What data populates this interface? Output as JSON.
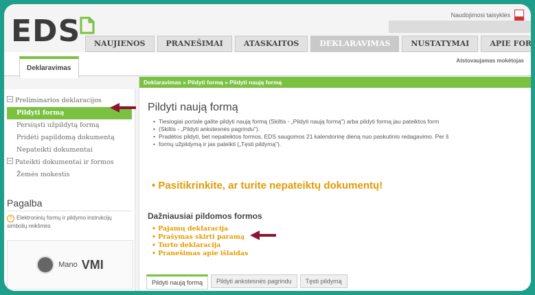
{
  "brand": {
    "logo": "EDS"
  },
  "header": {
    "top_link": "Naudojimosi taisyklės",
    "tabs": [
      {
        "label": "NAUJIENOS",
        "active": false
      },
      {
        "label": "PRANEŠIMAI",
        "active": false
      },
      {
        "label": "ATASKAITOS",
        "active": false
      },
      {
        "label": "DEKLARAVIMAS",
        "active": true
      },
      {
        "label": "NUSTATYMAI",
        "active": false
      },
      {
        "label": "APIE FORMŲ TEIKIMĄ",
        "active": false
      }
    ]
  },
  "subnav": {
    "tab": "Deklaravimas",
    "right_text": "Atstovaujamas mokėtojas"
  },
  "sidebar": {
    "items": [
      {
        "label": "Preliminarios deklaracijos",
        "group": true,
        "active": false
      },
      {
        "label": "Pildyti formą",
        "group": false,
        "active": true
      },
      {
        "label": "Persiųsti užpildytą formą",
        "group": false,
        "active": false
      },
      {
        "label": "Pridėti papildomą dokumentą",
        "group": false,
        "active": false
      },
      {
        "label": "Nepateikti dokumentai",
        "group": false,
        "active": false
      },
      {
        "label": "Pateikti dokumentai ir formos",
        "group": true,
        "active": false
      },
      {
        "label": "Žemės mokestis",
        "group": false,
        "active": false
      }
    ],
    "help_title": "Pagalba",
    "help_text": "Elektroninių formų ir pildymo instrukcijų simbolių reikšmės",
    "vmi_prefix": "Mano",
    "vmi_big": "VMI"
  },
  "main": {
    "breadcrumb": "Deklaravimas » Pildyti formą » Pildyti naują formą",
    "title": "Pildyti naują formą",
    "desc": [
      "Tiesiogiai portale galite pildyti naują formą (Skiltis - „Pildyti naują formą\") arba pildyti formą jau pateiktos form",
      "(Skiltis - „Pildyti ankstesnės pagrindu\").",
      "Pradėtos pildyti, bet nepateiktos formos, EDS saugomos 21 kalendorinę dieną nuo paskutinio redagavimo. Per š",
      "formų užpildymą ir jas pateikti („Tęsti pildymą\")."
    ],
    "check_text": "Pasitikrinkite, ar turite nepateiktų dokumentų!",
    "faq_title": "Dažniausiai pildomos formos",
    "forms": [
      "Pajamų deklaracija",
      "Prašymas skirti paramą",
      "Turto deklaracija",
      "Pranešimas apie išlaidas"
    ],
    "bottom_tabs": [
      {
        "label": "Pildyti naują formą",
        "active": true
      },
      {
        "label": "Pildyti ankstesnės pagrindu",
        "active": false
      },
      {
        "label": "Tęsti pildymą",
        "active": false
      }
    ]
  },
  "colors": {
    "frame": "#1f9e8c",
    "accent": "#7ac142",
    "orange": "#e39a00",
    "arrow": "#8b1530"
  },
  "icons": [
    "pdf-icon",
    "logo-document-icon",
    "collapse-box-icon",
    "help-circle-icon",
    "mano-vmi-icon",
    "annotation-arrow-icon"
  ]
}
